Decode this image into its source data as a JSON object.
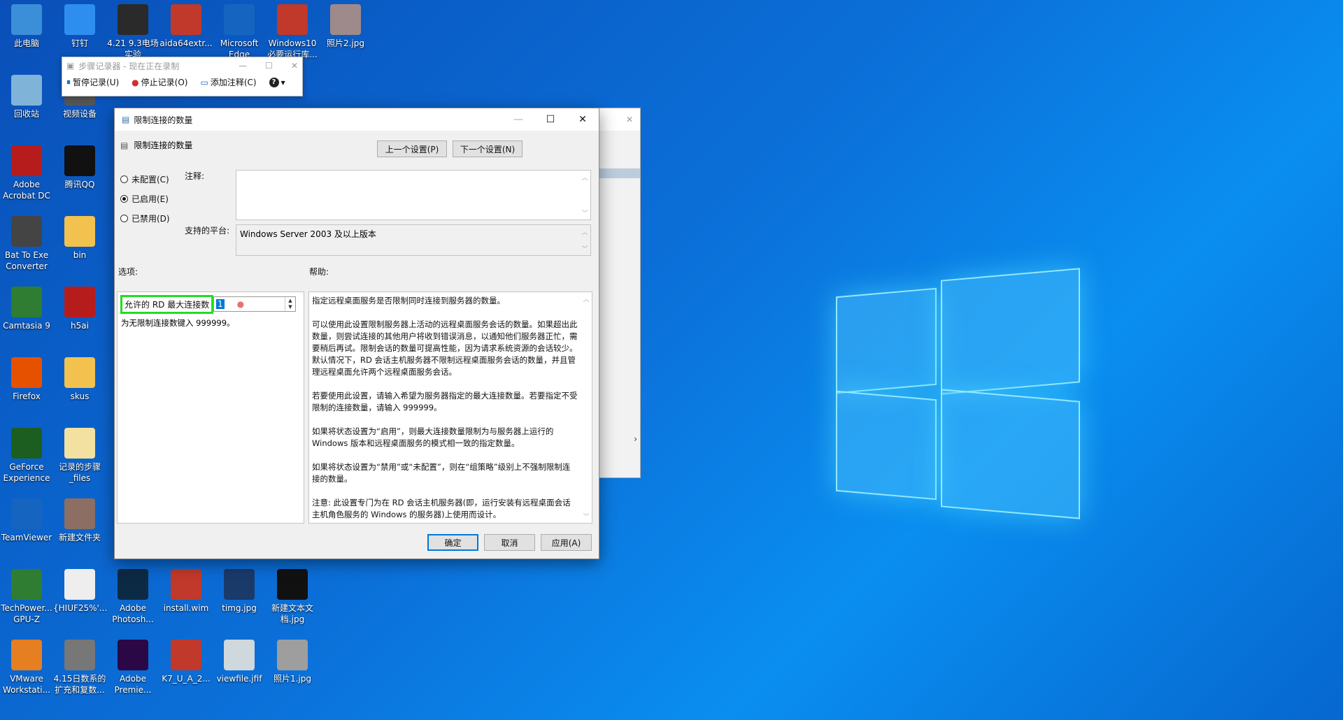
{
  "desktop": {
    "icons": [
      {
        "label": "此电脑",
        "color": "#3a8fd8"
      },
      {
        "label": "钉钉",
        "color": "#2e8ef0"
      },
      {
        "label": "4.21 9.3电场 实验",
        "color": "#2a2a2a"
      },
      {
        "label": "aida64extr...",
        "color": "#c0392b"
      },
      {
        "label": "Microsoft Edge",
        "color": "#1565c0"
      },
      {
        "label": "Windows10 必要运行库...",
        "color": "#c0392b"
      },
      {
        "label": "照片2.jpg",
        "color": "#9e8a8a"
      },
      {
        "label": "回收站",
        "color": "#7fb3d8"
      },
      {
        "label": "视频设备",
        "color": "#555555"
      },
      {
        "label": "Adobe Acrobat DC",
        "color": "#b71c1c"
      },
      {
        "label": "腾讯QQ",
        "color": "#111111"
      },
      {
        "label": "Bat To Exe Converter",
        "color": "#444444"
      },
      {
        "label": "bin",
        "color": "#f2c14e"
      },
      {
        "label": "Camtasia 9",
        "color": "#2e7d32"
      },
      {
        "label": "h5ai",
        "color": "#b71c1c"
      },
      {
        "label": "Firefox",
        "color": "#e65100"
      },
      {
        "label": "skus",
        "color": "#f2c14e"
      },
      {
        "label": "GeForce Experience",
        "color": "#1b5e20"
      },
      {
        "label": "记录的步骤_files",
        "color": "#f2e1a0"
      },
      {
        "label": "TeamViewer",
        "color": "#1565c0"
      },
      {
        "label": "新建文件夹",
        "color": "#8d6e63"
      },
      {
        "label": "TechPower... GPU-Z",
        "color": "#2e7d32"
      },
      {
        "label": "{HIUF25%'...",
        "color": "#eeeeee"
      },
      {
        "label": "Adobe Photosh...",
        "color": "#0d2a44"
      },
      {
        "label": "install.wim",
        "color": "#c0392b"
      },
      {
        "label": "timg.jpg",
        "color": "#1a3a6a"
      },
      {
        "label": "新建文本文档.jpg",
        "color": "#111111"
      },
      {
        "label": "VMware Workstati...",
        "color": "#e67e22"
      },
      {
        "label": "4.15日数系的扩充和复数...",
        "color": "#777777"
      },
      {
        "label": "Adobe Premie...",
        "color": "#2a0845"
      },
      {
        "label": "K7_U_A_2...",
        "color": "#c0392b"
      },
      {
        "label": "viewfile.jfif",
        "color": "#cfd8dc"
      },
      {
        "label": "照片1.jpg",
        "color": "#9e9e9e"
      }
    ]
  },
  "recorder": {
    "title": "步骤记录器 - 现在正在录制",
    "pause": "暂停记录(U)",
    "stop": "停止记录(O)",
    "comment": "添加注释(C)",
    "help": "?"
  },
  "dialog": {
    "title": "限制连接的数量",
    "header": "限制连接的数量",
    "prev_button": "上一个设置(P)",
    "next_button": "下一个设置(N)",
    "radio_not_configured": "未配置(C)",
    "radio_enabled": "已启用(E)",
    "radio_disabled": "已禁用(D)",
    "comment_label": "注释:",
    "platform_label": "支持的平台:",
    "platform_value": "Windows Server 2003 及以上版本",
    "options_label": "选项:",
    "help_label": "帮助:",
    "option_field_label": "允许的 RD 最大连接数",
    "option_value": "1",
    "option_hint": "为无限制连接数键入 999999。",
    "help_paragraphs": [
      "指定远程桌面服务是否限制同时连接到服务器的数量。",
      "可以使用此设置限制服务器上活动的远程桌面服务会话的数量。如果超出此数量，则尝试连接的其他用户将收到错误消息，以通知他们服务器正忙，需要稍后再试。限制会话的数量可提高性能，因为请求系统资源的会话较少。默认情况下，RD 会话主机服务器不限制远程桌面服务会话的数量，并且管理远程桌面允许两个远程桌面服务会话。",
      "若要使用此设置，请输入希望为服务器指定的最大连接数量。若要指定不受限制的连接数量，请输入 999999。",
      "如果将状态设置为“启用”，则最大连接数量限制为与服务器上运行的 Windows 版本和远程桌面服务的模式相一致的指定数量。",
      "如果将状态设置为“禁用”或“未配置”，则在“组策略”级别上不强制限制连接的数量。",
      "注意: 此设置专门为在 RD 会话主机服务器(即，运行安装有远程桌面会话主机角色服务的 Windows 的服务器)上使用而设计。"
    ],
    "ok_button": "确定",
    "cancel_button": "取消",
    "apply_button": "应用(A)"
  }
}
